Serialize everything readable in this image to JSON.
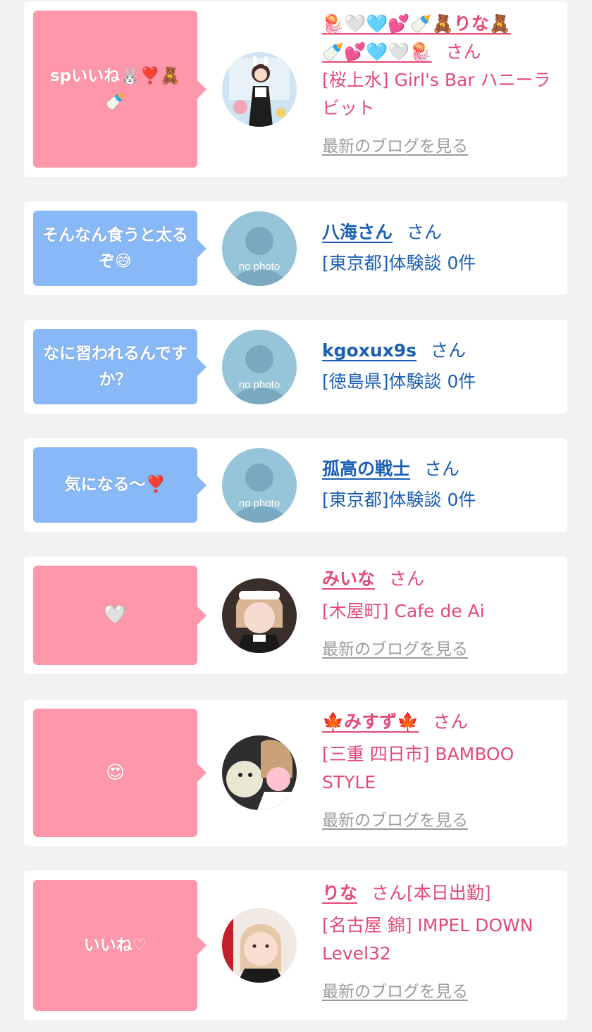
{
  "blog_link_label": "最新のブログを見る",
  "no_photo_label": "no photo",
  "colors": {
    "pink": "#e34a76",
    "blue": "#1b5fb4",
    "bubble_pink": "#ff97aa",
    "bubble_blue": "#89b8f7"
  },
  "items": [
    {
      "message": "spいいね🐰❣️🧸🍼",
      "name_line1": "🪼🤍🩵💕🍼🧸りな🧸",
      "name_line2": "🍼💕🩵🤍🪼",
      "suffix": "さん",
      "desc": "[桜上水] Girl's Bar ハニーラビット",
      "has_blog": true
    },
    {
      "message": "そんなん食うと太るぞ😅",
      "name": "八海さん",
      "suffix": "さん",
      "desc": "[東京都]体験談 0件",
      "has_blog": false
    },
    {
      "message": "なに習われるんですか？",
      "name": "kgoxux9s",
      "suffix": "さん",
      "desc": "[徳島県]体験談 0件",
      "has_blog": false
    },
    {
      "message": "気になる〜❣️",
      "name": "孤高の戦士",
      "suffix": "さん",
      "desc": "[東京都]体験談 0件",
      "has_blog": false
    },
    {
      "message": "🤍",
      "name": "みいな",
      "suffix": "さん",
      "desc": "[木屋町] Cafe de Ai",
      "has_blog": true
    },
    {
      "message": "😍",
      "name": "🍁みすず🍁",
      "suffix": "さん",
      "desc": "[三重 四日市] BAMBOO STYLE",
      "has_blog": true
    },
    {
      "message": "いいね♡",
      "name": "りな",
      "suffix": "さん",
      "extra": "[本日出勤]",
      "desc": "[名古屋 錦] IMPEL DOWN Level32",
      "has_blog": true
    }
  ]
}
